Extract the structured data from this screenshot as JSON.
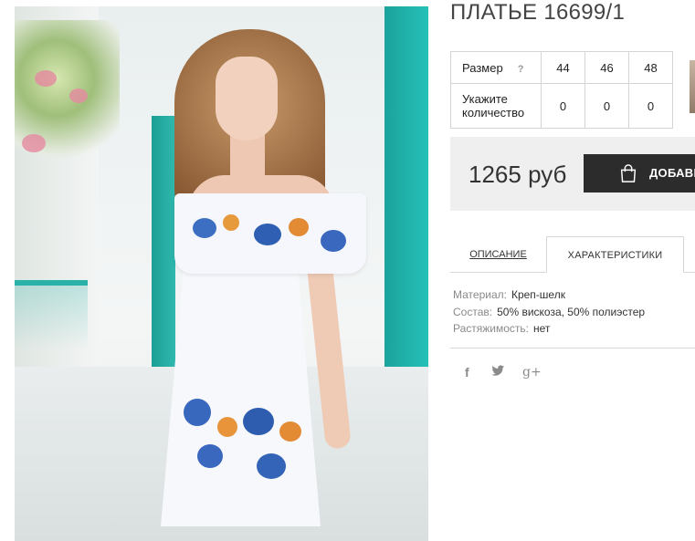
{
  "product": {
    "title": "ПЛАТЬЕ 16699/1"
  },
  "size_table": {
    "size_label": "Размер",
    "help_mark": "?",
    "sizes": [
      "44",
      "46",
      "48"
    ],
    "quantity_label": "Укажите количество",
    "quantities": [
      "0",
      "0",
      "0"
    ]
  },
  "buy": {
    "price": "1265 руб",
    "add_button_label": "ДОБАВИТ"
  },
  "tabs": {
    "description": "ОПИСАНИЕ",
    "characteristics": "ХАРАКТЕРИСТИКИ"
  },
  "specs": [
    {
      "key": "Материал:",
      "value": "Креп-шелк"
    },
    {
      "key": "Состав:",
      "value": "50% вискоза, 50% полиэстер"
    },
    {
      "key": "Растяжимость:",
      "value": "нет"
    }
  ],
  "social": {
    "facebook": "f",
    "twitter": "🐦",
    "google_plus": "g+"
  },
  "colors": {
    "button_bg": "#2c2c2c",
    "buybox_bg": "#efefef",
    "door_teal": "#25c0b8"
  }
}
